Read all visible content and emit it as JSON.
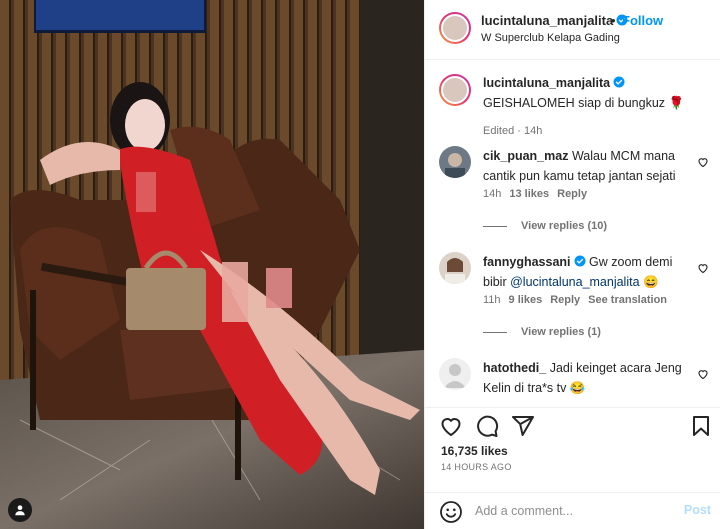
{
  "post": {
    "username": "lucintaluna_manjalita",
    "separator": "•",
    "follow_label": "Follow",
    "location": "W Superclub Kelapa Gading"
  },
  "caption": {
    "username": "lucintaluna_manjalita",
    "text": "GEISHALOMEH siap di bungkuz 🌹",
    "meta": "Edited · 14h"
  },
  "comments": [
    {
      "username": "cik_puan_maz",
      "text": "Walau MCM mana cantik pun kamu tetap jantan sejati",
      "time": "14h",
      "likes": "13 likes",
      "reply": "Reply",
      "view_replies": "View replies (10)"
    },
    {
      "username": "fannyghassani",
      "text": "Gw zoom demi bibir",
      "mention": "@lucintaluna_manjalita",
      "emoji": "😄",
      "time": "11h",
      "likes": "9 likes",
      "reply": "Reply",
      "see_translation": "See translation",
      "view_replies": "View replies (1)"
    },
    {
      "username": "hatothedi_",
      "text": "Jadi keinget acara Jeng Kelin di tra*s tv 😂"
    }
  ],
  "actions": {
    "likes": "16,735 likes",
    "time": "14 HOURS AGO",
    "icons": [
      "heart-icon",
      "comment-icon",
      "share-icon",
      "bookmark-icon"
    ]
  },
  "add_comment": {
    "placeholder": "Add a comment...",
    "post_label": "Post"
  },
  "colors": {
    "accent": "#0095f6",
    "verified": "#0095f6",
    "post_disabled": "#b2dffc",
    "muted": "#737373"
  }
}
